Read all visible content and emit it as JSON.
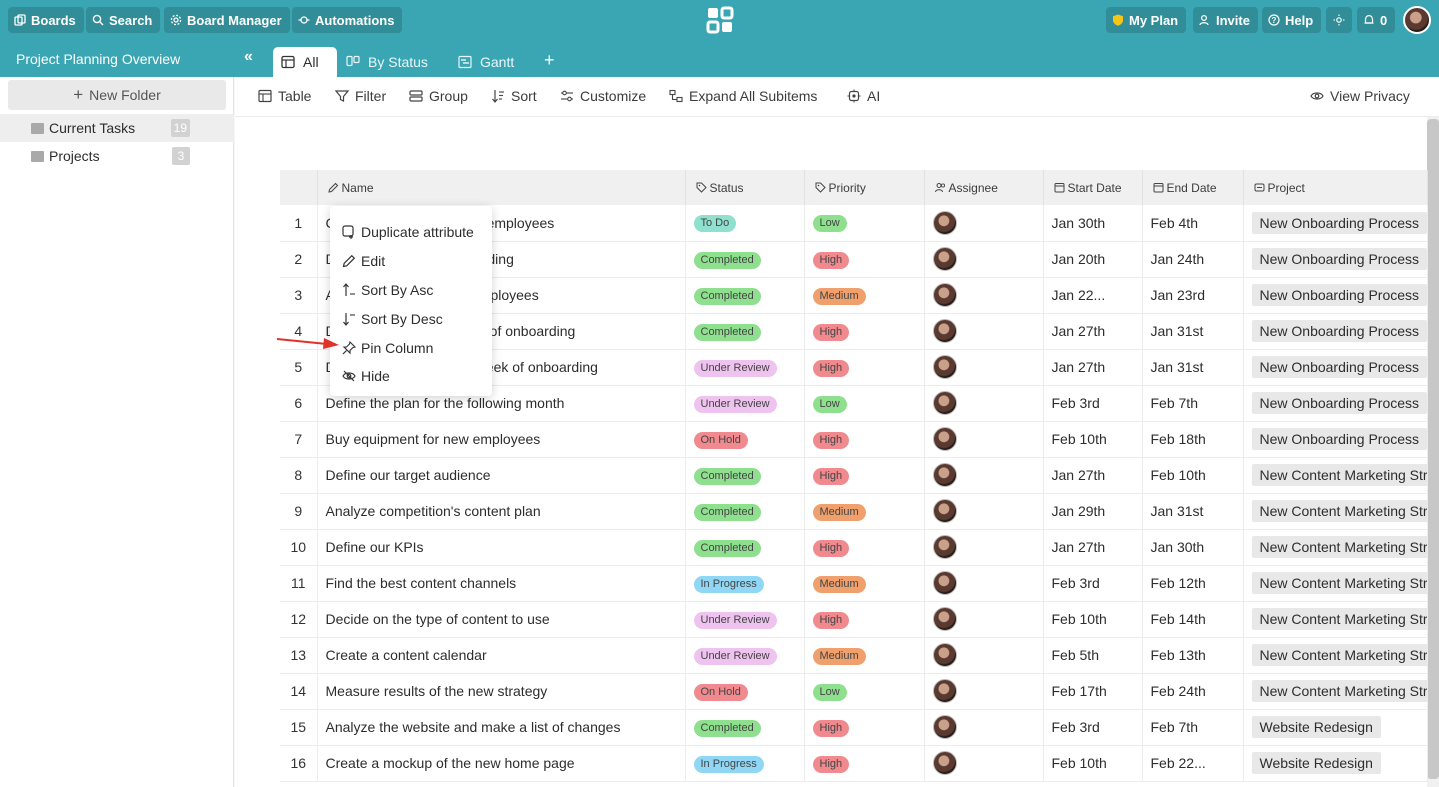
{
  "topbar": {
    "boards": "Boards",
    "search": "Search",
    "board_manager": "Board Manager",
    "automations": "Automations",
    "my_plan": "My Plan",
    "invite": "Invite",
    "help": "Help",
    "notifications": "0"
  },
  "board": {
    "title": "Project Planning Overview"
  },
  "tabs": [
    {
      "label": "All"
    },
    {
      "label": "By Status"
    },
    {
      "label": "Gantt"
    }
  ],
  "sidebar": {
    "new_folder": "New Folder",
    "folders": [
      {
        "name": "Current Tasks",
        "count": "19"
      },
      {
        "name": "Projects",
        "count": "3"
      }
    ]
  },
  "toolbar": {
    "table": "Table",
    "filter": "Filter",
    "group": "Group",
    "sort": "Sort",
    "customize": "Customize",
    "expand": "Expand All Subitems",
    "ai": "AI",
    "privacy": "View Privacy"
  },
  "columns": [
    "Name",
    "Status",
    "Priority",
    "Assignee",
    "Start Date",
    "End Date",
    "Project"
  ],
  "colors": {
    "To Do": "#8fe0cf",
    "Completed": "#8ee08e",
    "Under Review": "#efc3ef",
    "On Hold": "#f08a8e",
    "In Progress": "#8fd7f5",
    "Low": "#8ee08e",
    "High": "#f08a8e",
    "Medium": "#f0a06c"
  },
  "rows": [
    {
      "num": "1",
      "name": "Create resources for new employees",
      "status": "To Do",
      "priority": "Low",
      "start": "Jan 30th",
      "end": "Feb 4th",
      "project": "New Onboarding Process"
    },
    {
      "num": "2",
      "name": "Define the plan for onboarding",
      "status": "Completed",
      "priority": "High",
      "start": "Jan 20th",
      "end": "Jan 24th",
      "project": "New Onboarding Process"
    },
    {
      "num": "3",
      "name": "Assign mentors to new employees",
      "status": "Completed",
      "priority": "Medium",
      "start": "Jan 22...",
      "end": "Jan 23rd",
      "project": "New Onboarding Process"
    },
    {
      "num": "4",
      "name": "Define tasks for first week of onboarding",
      "status": "Completed",
      "priority": "High",
      "start": "Jan 27th",
      "end": "Jan 31st",
      "project": "New Onboarding Process"
    },
    {
      "num": "5",
      "name": "Define tasks for second week of onboarding",
      "status": "Under Review",
      "priority": "High",
      "start": "Jan 27th",
      "end": "Jan 31st",
      "project": "New Onboarding Process"
    },
    {
      "num": "6",
      "name": "Define the plan for the following month",
      "status": "Under Review",
      "priority": "Low",
      "start": "Feb 3rd",
      "end": "Feb 7th",
      "project": "New Onboarding Process"
    },
    {
      "num": "7",
      "name": "Buy equipment for new employees",
      "status": "On Hold",
      "priority": "High",
      "start": "Feb 10th",
      "end": "Feb 18th",
      "project": "New Onboarding Process"
    },
    {
      "num": "8",
      "name": "Define our target audience",
      "status": "Completed",
      "priority": "High",
      "start": "Jan 27th",
      "end": "Feb 10th",
      "project": "New Content Marketing Strategy"
    },
    {
      "num": "9",
      "name": "Analyze competition's content plan",
      "status": "Completed",
      "priority": "Medium",
      "start": "Jan 29th",
      "end": "Jan 31st",
      "project": "New Content Marketing Strategy"
    },
    {
      "num": "10",
      "name": "Define our KPIs",
      "status": "Completed",
      "priority": "High",
      "start": "Jan 27th",
      "end": "Jan 30th",
      "project": "New Content Marketing Strategy"
    },
    {
      "num": "11",
      "name": "Find the best content channels",
      "status": "In Progress",
      "priority": "Medium",
      "start": "Feb 3rd",
      "end": "Feb 12th",
      "project": "New Content Marketing Strategy"
    },
    {
      "num": "12",
      "name": "Decide on the type of content to use",
      "status": "Under Review",
      "priority": "High",
      "start": "Feb 10th",
      "end": "Feb 14th",
      "project": "New Content Marketing Strategy"
    },
    {
      "num": "13",
      "name": "Create a content calendar",
      "status": "Under Review",
      "priority": "Medium",
      "start": "Feb 5th",
      "end": "Feb 13th",
      "project": "New Content Marketing Strategy"
    },
    {
      "num": "14",
      "name": "Measure results of the new strategy",
      "status": "On Hold",
      "priority": "Low",
      "start": "Feb 17th",
      "end": "Feb 24th",
      "project": "New Content Marketing Strategy"
    },
    {
      "num": "15",
      "name": "Analyze the website and make a list of changes",
      "status": "Completed",
      "priority": "High",
      "start": "Feb 3rd",
      "end": "Feb 7th",
      "project": "Website Redesign"
    },
    {
      "num": "16",
      "name": "Create a mockup of the new home page",
      "status": "In Progress",
      "priority": "High",
      "start": "Feb 10th",
      "end": "Feb 22...",
      "project": "Website Redesign"
    }
  ],
  "context_menu": {
    "items": [
      "Duplicate attribute",
      "Edit",
      "Sort By Asc",
      "Sort By Desc",
      "Pin Column",
      "Hide"
    ]
  }
}
